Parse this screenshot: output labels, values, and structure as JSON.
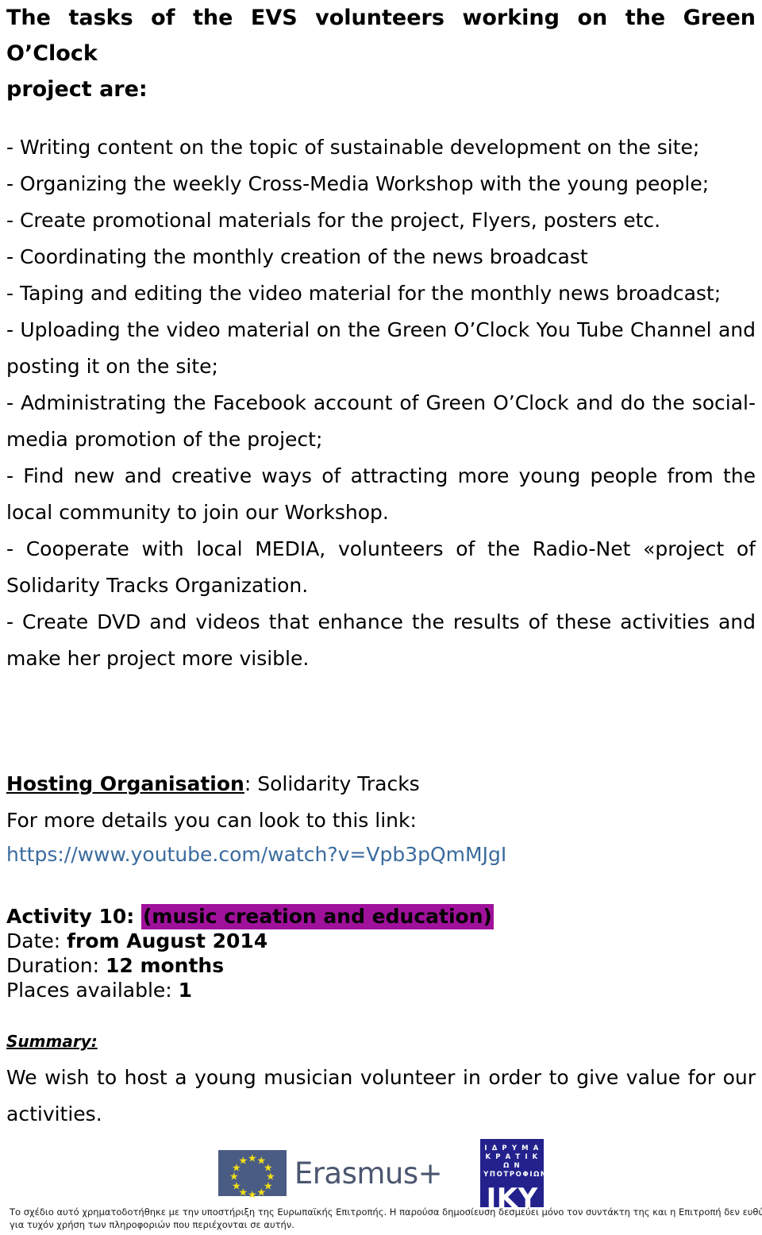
{
  "document": {
    "title_line1": "The tasks of the EVS volunteers working on the Green O’Clock",
    "title_line2": "project are:",
    "tasks": [
      "- Writing content on the topic of sustainable development on the site;",
      "- Organizing the weekly Cross-Media Workshop with the young people;",
      "- Create promotional materials for the project, Flyers, posters etc.",
      "- Coordinating the monthly creation of the news broadcast",
      "- Taping and editing the video material for the monthly news broadcast;",
      "- Uploading the video material on the Green O’Clock You Tube Channel and posting it on the site;",
      "- Administrating the Facebook account of Green O’Clock and do the social-media promotion of the project;",
      "- Find new and creative ways of attracting more young people from the local community to join our Workshop.",
      "- Cooperate with local MEDIA, volunteers of the Radio-Net «project of Solidarity Tracks Organization.",
      "- Create DVD and videos that enhance the results of these activities and make her project more visible."
    ],
    "hosting": {
      "label": "Hosting Organisation",
      "separator": ": ",
      "value": "Solidarity Tracks"
    },
    "more_details_text": "For more details you can look to this link:",
    "link_text": "https://www.youtube.com/watch?v=Vpb3pQmMJgI",
    "activity": {
      "title_label": "Activity 10: ",
      "title_highlight": "(music creation and education)",
      "highlight_color": "#A0119B",
      "date_label": "Date: ",
      "date_value": "from August 2014",
      "duration_label": "Duration: ",
      "duration_value": "12 months",
      "places_label": "Places available: ",
      "places_value": "1"
    },
    "summary": {
      "heading": "Summary:",
      "body": "We wish to host a young musician volunteer in order to give value for our activities."
    }
  },
  "footer": {
    "erasmus": {
      "wordmark": "Erasmus+",
      "flag_color": "#4B5C84",
      "star_color": "#F2DF18",
      "text_color": "#4B5670"
    },
    "iky": {
      "line1": "Ι Δ Ρ Υ Μ Α",
      "line2": "Κ Ρ Α Τ Ι Κ Ω Ν",
      "line3": "ΥΠΟΤΡΟΦΙΩΝ",
      "acronym": "IKY",
      "background_color": "#23218C"
    },
    "disclaimer_line1": "Το σχέδιο αυτό χρηματοδοτήθηκε με την υποστήριξη της Ευρωπαϊκής Επιτροπής. Η παρούσα δημοσίευση δεσμεύει μόνο τον συντάκτη της και η Επιτροπή δεν ευθύνεται",
    "disclaimer_line2": "για τυχόν χρήση των πληροφοριών που περιέχονται σε αυτήν."
  }
}
